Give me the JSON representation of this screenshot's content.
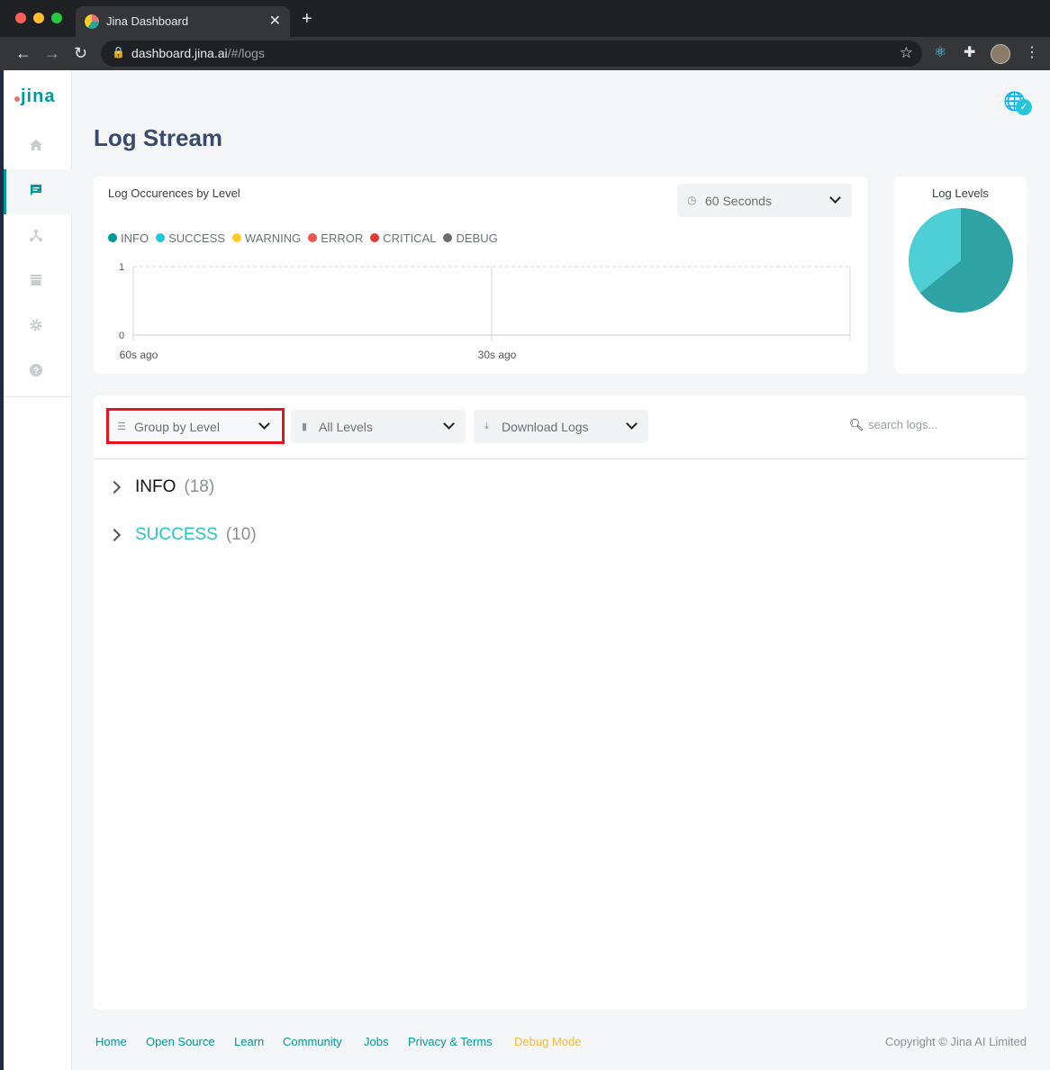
{
  "browser": {
    "tab_title": "Jina Dashboard",
    "url_host": "dashboard.jina.ai",
    "url_path": "/#/logs"
  },
  "sidebar": {
    "logo": "jina",
    "items": [
      {
        "name": "home",
        "icon": "home-icon"
      },
      {
        "name": "logs",
        "icon": "chat-icon",
        "active": true
      },
      {
        "name": "flow",
        "icon": "flow-icon"
      },
      {
        "name": "hub",
        "icon": "store-icon"
      },
      {
        "name": "settings",
        "icon": "gear-icon"
      },
      {
        "name": "help",
        "icon": "help-icon"
      }
    ]
  },
  "page": {
    "title": "Log Stream"
  },
  "occurrences": {
    "title": "Log Occurences by Level",
    "time_range": "60 Seconds",
    "legend": [
      {
        "label": "INFO",
        "color": "#009999"
      },
      {
        "label": "SUCCESS",
        "color": "#26c6da"
      },
      {
        "label": "WARNING",
        "color": "#ffca28"
      },
      {
        "label": "ERROR",
        "color": "#ef5350"
      },
      {
        "label": "CRITICAL",
        "color": "#e53935"
      },
      {
        "label": "DEBUG",
        "color": "#6d6d6d"
      }
    ]
  },
  "levels": {
    "title": "Log Levels"
  },
  "logs": {
    "group_by": "Group by Level",
    "level_filter": "All Levels",
    "download": "Download Logs",
    "search_placeholder": "search logs...",
    "groups": [
      {
        "name": "INFO",
        "count": "(18)"
      },
      {
        "name": "SUCCESS",
        "count": "(10)"
      }
    ]
  },
  "footer": {
    "links": [
      "Home",
      "Open Source",
      "Learn",
      "Community",
      "Jobs",
      "Privacy & Terms",
      "Debug Mode"
    ],
    "copyright": "Copyright © Jina AI Limited"
  },
  "chart_data": [
    {
      "type": "line",
      "title": "Log Occurences by Level",
      "x_ticks": [
        "60s ago",
        "30s ago"
      ],
      "y_ticks": [
        0,
        1
      ],
      "ylim": [
        0,
        1
      ],
      "grid": true,
      "legend_position": "top-left",
      "series": [
        {
          "name": "INFO",
          "color": "#009999",
          "values": []
        },
        {
          "name": "SUCCESS",
          "color": "#26c6da",
          "values": []
        },
        {
          "name": "WARNING",
          "color": "#ffca28",
          "values": []
        },
        {
          "name": "ERROR",
          "color": "#ef5350",
          "values": []
        },
        {
          "name": "CRITICAL",
          "color": "#e53935",
          "values": []
        },
        {
          "name": "DEBUG",
          "color": "#6d6d6d",
          "values": []
        }
      ]
    },
    {
      "type": "pie",
      "title": "Log Levels",
      "categories": [
        "INFO",
        "SUCCESS"
      ],
      "values": [
        18,
        10
      ],
      "colors": [
        "#2fa3a3",
        "#4ecfd6"
      ]
    }
  ]
}
